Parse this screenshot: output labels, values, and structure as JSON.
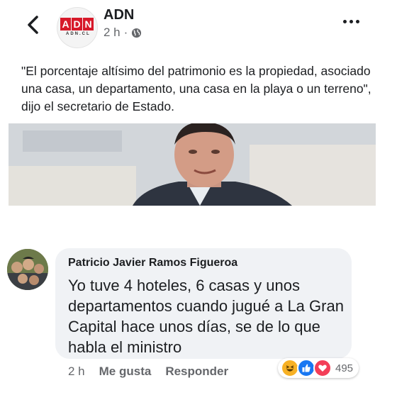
{
  "post": {
    "page_name": "ADN",
    "logo_letters": [
      "A",
      "D",
      "N"
    ],
    "logo_sub": "ADN.CL",
    "time": "2 h",
    "separator": "·",
    "text": "\"El porcentaje altísimo del patrimonio es la propiedad, asociado una casa, un departamento, una casa en la playa o un terreno\", dijo el secretario de Estado."
  },
  "comment": {
    "author": "Patricio Javier Ramos Figueroa",
    "text": "Yo tuve 4 hoteles, 6 casas y unos departamentos cuando jugué a La Gran Capital hace unos días, se de lo que habla el ministro",
    "time": "2 h",
    "like_label": "Me gusta",
    "reply_label": "Responder",
    "reaction_count": "495",
    "reactions": [
      "haha-icon",
      "like-icon",
      "love-icon"
    ]
  },
  "colors": {
    "brand_red": "#d7192a",
    "like_blue": "#1877f2",
    "love_red": "#f33e58",
    "haha_yellow": "#f7b125",
    "bubble_bg": "#f0f2f5"
  }
}
